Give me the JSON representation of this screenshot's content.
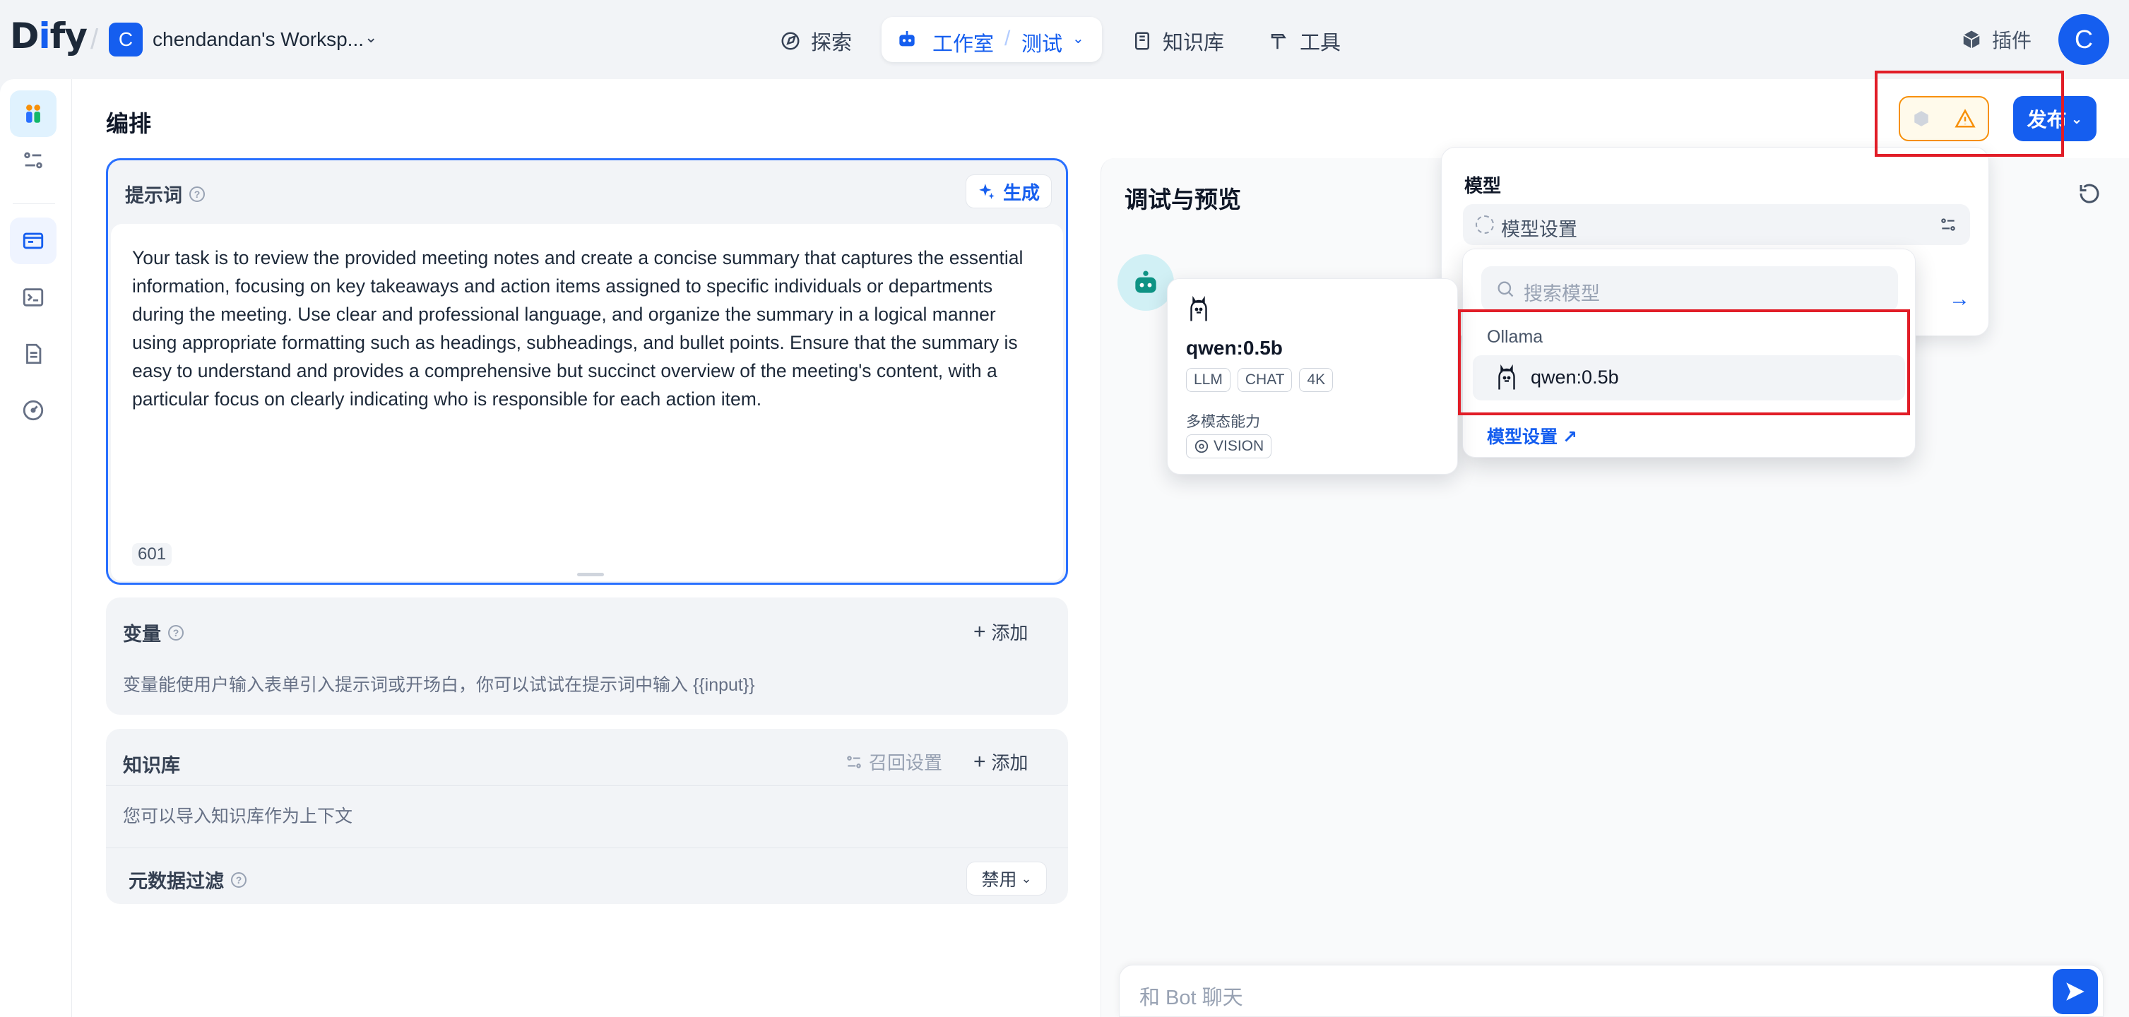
{
  "brand": {
    "logo_main": "D",
    "logo_accent": "i",
    "logo_end": "fy"
  },
  "workspace": {
    "initial": "C",
    "name": "chendandan's Worksp..."
  },
  "nav": {
    "explore": "探索",
    "studio": "工作室",
    "studio_sub": "测试",
    "knowledge": "知识库",
    "tools": "工具",
    "plugins": "插件"
  },
  "user": {
    "initial": "C"
  },
  "page": {
    "title": "编排",
    "publish": "发布"
  },
  "prompt": {
    "title": "提示词",
    "generate": "生成",
    "text": "Your task is to review the provided meeting notes and create a concise summary that captures the essential information, focusing on key takeaways and action items assigned to specific individuals or departments during the meeting. Use clear and professional language, and organize the summary in a logical manner using appropriate formatting such as headings, subheadings, and bullet points. Ensure that the summary is easy to understand and provides a comprehensive but succinct overview of the meeting's content, with a particular focus on clearly indicating who is responsible for each action item.",
    "char_count": "601"
  },
  "variables": {
    "title": "变量",
    "add": "添加",
    "desc": "变量能使用户输入表单引入提示词或开场白，你可以试试在提示词中输入 {{input}}"
  },
  "knowledge": {
    "title": "知识库",
    "recall": "召回设置",
    "add": "添加",
    "desc": "您可以导入知识库作为上下文",
    "metadata_filter": "元数据过滤",
    "disable": "禁用"
  },
  "preview": {
    "title": "调试与预览",
    "chat_placeholder": "和 Bot 聊天"
  },
  "model_panel": {
    "title": "模型",
    "setting": "模型设置"
  },
  "model_dropdown": {
    "search_placeholder": "搜索模型",
    "group": "Ollama",
    "option": "qwen:0.5b",
    "settings_link": "模型设置 ↗"
  },
  "model_card": {
    "name": "qwen:0.5b",
    "tags": [
      "LLM",
      "CHAT",
      "4K"
    ],
    "capability_label": "多模态能力",
    "vision": "VISION"
  },
  "colors": {
    "accent": "#155eef",
    "warning": "#f79009",
    "annotation": "#e11d27"
  }
}
